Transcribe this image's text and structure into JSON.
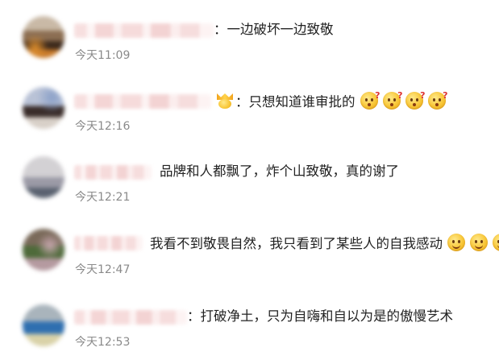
{
  "comments": [
    {
      "text": "：一边破坏一边致敬",
      "time": "今天11:09"
    },
    {
      "text": "：只想知道谁审批的",
      "time": "今天12:16",
      "badge_icon": "crown-emoji-icon",
      "emoji": [
        "question-face-icon",
        "question-face-icon",
        "question-face-icon",
        "question-face-icon"
      ]
    },
    {
      "text": "品牌和人都飘了，炸个山致敬，真的谢了",
      "time": "今天12:21"
    },
    {
      "text": "我看不到敬畏自然，我只看到了某些人的自我感动",
      "time": "今天12:47",
      "emoji": [
        "smile-face-icon",
        "smile-face-icon",
        "smile-face-icon"
      ]
    },
    {
      "text": "：打破净土，只为自嗨和自以为是的傲慢艺术",
      "time": "今天12:53"
    }
  ],
  "colors": {
    "text": "#222222",
    "time": "#8a8a8a",
    "name_blur": "#f4d3d3"
  }
}
